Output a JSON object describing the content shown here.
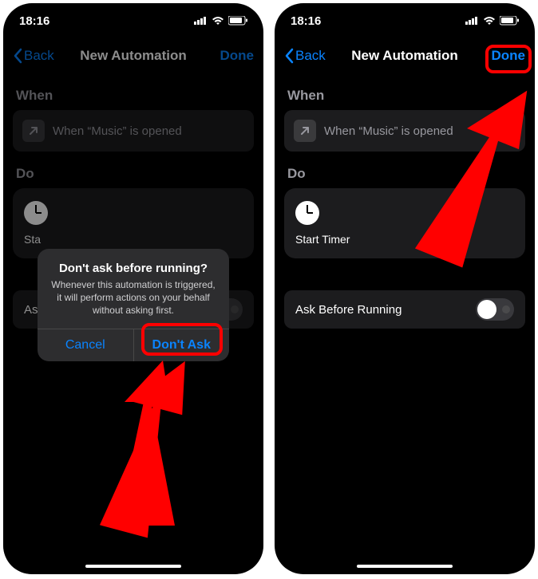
{
  "status": {
    "time": "18:16"
  },
  "nav": {
    "back": "Back",
    "title": "New Automation",
    "done": "Done"
  },
  "section": {
    "when": "When",
    "do": "Do"
  },
  "when_card": {
    "text": "When “Music” is opened"
  },
  "action": {
    "label": "Start Timer",
    "label_truncated": "Sta"
  },
  "ask": {
    "label": "Ask Before Running",
    "label_truncated": "Ask"
  },
  "alert": {
    "title": "Don't ask before running?",
    "message": "Whenever this automation is triggered, it will perform actions on your behalf without asking first.",
    "cancel": "Cancel",
    "confirm": "Don't Ask"
  }
}
